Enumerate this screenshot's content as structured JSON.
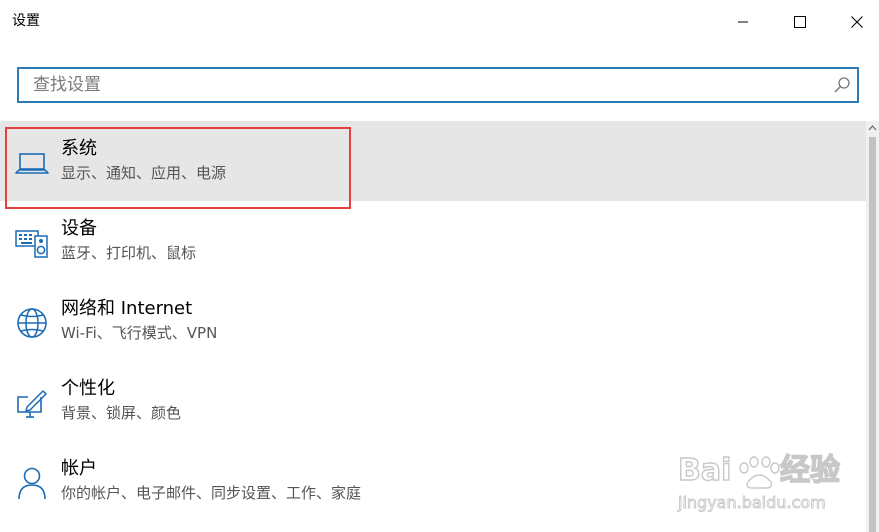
{
  "window": {
    "title": "设置",
    "minimize_icon": "minimize-icon",
    "maximize_icon": "maximize-icon",
    "close_icon": "close-icon"
  },
  "search": {
    "placeholder": "查找设置",
    "value": "",
    "icon": "search-icon"
  },
  "items": [
    {
      "label": "系统",
      "desc": "显示、通知、应用、电源",
      "icon": "laptop-icon",
      "selected": true
    },
    {
      "label": "设备",
      "desc": "蓝牙、打印机、鼠标",
      "icon": "devices-icon",
      "selected": false
    },
    {
      "label": "网络和 Internet",
      "desc": "Wi-Fi、飞行模式、VPN",
      "icon": "globe-icon",
      "selected": false
    },
    {
      "label": "个性化",
      "desc": "背景、锁屏、颜色",
      "icon": "personalization-icon",
      "selected": false
    },
    {
      "label": "帐户",
      "desc": "你的帐户、电子邮件、同步设置、工作、家庭",
      "icon": "person-icon",
      "selected": false
    }
  ],
  "watermark": {
    "logo_text": "Bai du 经验",
    "url": "jingyan.baidu.com"
  },
  "colors": {
    "accent": "#2c7bb6",
    "highlight_border": "#e5403f",
    "selected_bg": "#e6e6e6",
    "icon_blue": "#1b6cb5",
    "desc_gray": "#555555"
  }
}
